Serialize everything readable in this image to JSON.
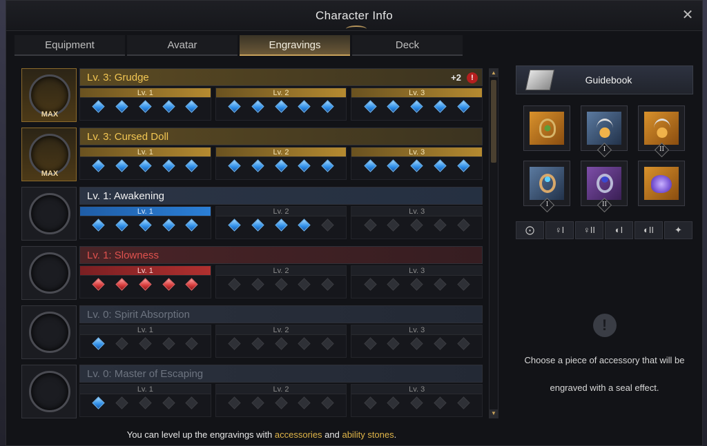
{
  "window": {
    "title": "Character Info",
    "close_icon": "close-icon"
  },
  "tabs": [
    {
      "label": "Equipment",
      "active": false
    },
    {
      "label": "Avatar",
      "active": false
    },
    {
      "label": "Engravings",
      "active": true
    },
    {
      "label": "Deck",
      "active": false
    }
  ],
  "level_labels": [
    "Lv. 1",
    "Lv. 2",
    "Lv. 3"
  ],
  "engravings": [
    {
      "name": "Lv. 3: Grudge",
      "style": "gold",
      "portrait_label": "MAX",
      "bonus": "+2",
      "alert": "!",
      "filled_levels": 3,
      "gem_color": "blue",
      "gems_filled": 15
    },
    {
      "name": "Lv. 3: Cursed Doll",
      "style": "gold",
      "portrait_label": "MAX",
      "bonus": "",
      "alert": "",
      "filled_levels": 3,
      "gem_color": "blue",
      "gems_filled": 15
    },
    {
      "name": "Lv. 1: Awakening",
      "style": "blue",
      "portrait_label": "",
      "bonus": "",
      "alert": "",
      "filled_levels": 1,
      "gem_color": "blue",
      "gems_filled": 9
    },
    {
      "name": "Lv. 1: Slowness",
      "style": "red",
      "portrait_label": "",
      "bonus": "",
      "alert": "",
      "filled_levels": 1,
      "gem_color": "red",
      "gems_filled": 5
    },
    {
      "name": "Lv. 0: Spirit Absorption",
      "style": "dim",
      "portrait_label": "",
      "bonus": "",
      "alert": "",
      "filled_levels": 0,
      "gem_color": "blue",
      "gems_filled": 1
    },
    {
      "name": "Lv. 0: Master of Escaping",
      "style": "dim",
      "portrait_label": "",
      "bonus": "",
      "alert": "",
      "filled_levels": 0,
      "gem_color": "blue",
      "gems_filled": 1
    }
  ],
  "footer": {
    "prefix": "You can level up the engravings with ",
    "link1": "accessories",
    "middle": " and ",
    "link2": "ability stones",
    "suffix": "."
  },
  "panel": {
    "guidebook_label": "Guidebook",
    "accessories": [
      {
        "name": "necklace",
        "bg": "orange",
        "tier": ""
      },
      {
        "name": "earring",
        "bg": "blue",
        "tier": "I"
      },
      {
        "name": "earring",
        "bg": "orange",
        "tier": "II"
      },
      {
        "name": "ring",
        "bg": "blue",
        "tier": "I"
      },
      {
        "name": "ring2",
        "bg": "purple",
        "tier": "II"
      },
      {
        "name": "stone",
        "bg": "orange",
        "tier": ""
      }
    ],
    "filters": [
      "necklace-filter-icon",
      "earring-1-filter-icon",
      "earring-2-filter-icon",
      "ring-1-filter-icon",
      "ring-2-filter-icon",
      "stone-filter-icon"
    ],
    "info_icon": "!",
    "info_line1": "Choose a piece of accessory that will be",
    "info_line2": "engraved with a seal effect."
  }
}
